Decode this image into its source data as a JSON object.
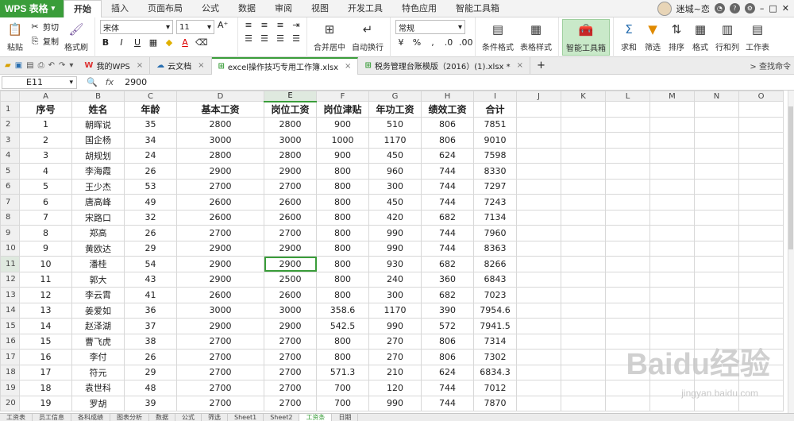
{
  "app": {
    "brand": "WPS 表格",
    "user_name": "迷城~恋"
  },
  "menu": {
    "tabs": [
      "开始",
      "插入",
      "页面布局",
      "公式",
      "数据",
      "审阅",
      "视图",
      "开发工具",
      "特色应用",
      "智能工具箱"
    ],
    "active_index": 0
  },
  "ribbon": {
    "paste": "粘贴",
    "cut": "剪切",
    "copy": "复制",
    "format_painter": "格式刷",
    "font_name": "宋体",
    "font_size": "11",
    "bold": "B",
    "italic": "I",
    "underline": "U",
    "merge_center": "合并居中",
    "wrap_text": "自动换行",
    "number_format": "常规",
    "conditional_format": "条件格式",
    "table_style": "表格样式",
    "smart_toolbox": "智能工具箱",
    "sum": "求和",
    "filter": "筛选",
    "sort": "排序",
    "format": "格式",
    "rows_cols": "行和列",
    "worksheet": "工作表"
  },
  "tabs": {
    "items": [
      "我的WPS",
      "云文档",
      "excel操作技巧专用工作簿.xlsx",
      "税务管理台账模版（2016）(1).xlsx *"
    ],
    "active_index": 2,
    "find": "查找命令"
  },
  "formula_bar": {
    "cell_ref": "E11",
    "value": "2900"
  },
  "sheet": {
    "columns": [
      "A",
      "B",
      "C",
      "D",
      "E",
      "F",
      "G",
      "H",
      "I",
      "J",
      "K",
      "L",
      "M",
      "N",
      "O"
    ],
    "headers": [
      "序号",
      "姓名",
      "年龄",
      "基本工资",
      "岗位工资",
      "岗位津贴",
      "年功工资",
      "绩效工资",
      "合计"
    ],
    "rows": [
      [
        "1",
        "朝晖说",
        "35",
        "2800",
        "2800",
        "900",
        "510",
        "806",
        "7851"
      ],
      [
        "2",
        "国企杨",
        "34",
        "3000",
        "3000",
        "1000",
        "1170",
        "806",
        "9010"
      ],
      [
        "3",
        "胡规划",
        "24",
        "2800",
        "2800",
        "900",
        "450",
        "624",
        "7598"
      ],
      [
        "4",
        "李海霞",
        "26",
        "2900",
        "2900",
        "800",
        "960",
        "744",
        "8330"
      ],
      [
        "5",
        "王少杰",
        "53",
        "2700",
        "2700",
        "800",
        "300",
        "744",
        "7297"
      ],
      [
        "6",
        "唐高峰",
        "49",
        "2600",
        "2600",
        "800",
        "450",
        "744",
        "7243"
      ],
      [
        "7",
        "宋路口",
        "32",
        "2600",
        "2600",
        "800",
        "420",
        "682",
        "7134"
      ],
      [
        "8",
        "郑高",
        "26",
        "2700",
        "2700",
        "800",
        "990",
        "744",
        "7960"
      ],
      [
        "9",
        "黄欧达",
        "29",
        "2900",
        "2900",
        "800",
        "990",
        "744",
        "8363"
      ],
      [
        "10",
        "潘桂",
        "54",
        "2900",
        "2900",
        "800",
        "930",
        "682",
        "8266"
      ],
      [
        "11",
        "郭大",
        "43",
        "2900",
        "2500",
        "800",
        "240",
        "360",
        "6843"
      ],
      [
        "12",
        "李云霄",
        "41",
        "2600",
        "2600",
        "800",
        "300",
        "682",
        "7023"
      ],
      [
        "13",
        "姜爱如",
        "36",
        "3000",
        "3000",
        "358.6",
        "1170",
        "390",
        "7954.6"
      ],
      [
        "14",
        "赵泽湖",
        "37",
        "2900",
        "2900",
        "542.5",
        "990",
        "572",
        "7941.5"
      ],
      [
        "15",
        "曹飞虎",
        "38",
        "2700",
        "2700",
        "800",
        "270",
        "806",
        "7314"
      ],
      [
        "16",
        "李付",
        "26",
        "2700",
        "2700",
        "800",
        "270",
        "806",
        "7302"
      ],
      [
        "17",
        "符元",
        "29",
        "2700",
        "2700",
        "571.3",
        "210",
        "624",
        "6834.3"
      ],
      [
        "18",
        "袁世科",
        "48",
        "2700",
        "2700",
        "700",
        "120",
        "744",
        "7012"
      ],
      [
        "19",
        "罗胡",
        "39",
        "2700",
        "2700",
        "700",
        "990",
        "744",
        "7870"
      ]
    ],
    "selected_cell": "E11"
  },
  "sheet_tabs": [
    "工资表",
    "员工信息",
    "各科成绩",
    "图表分析",
    "数据",
    "公式",
    "筛选",
    "Sheet1",
    "Sheet2",
    "工资条",
    "日期"
  ],
  "watermark": {
    "main": "Baidu经验",
    "sub": "jingyan.baidu.com"
  },
  "colors": {
    "accent": "#3a9d3a",
    "selection": "#3a9d3a"
  }
}
